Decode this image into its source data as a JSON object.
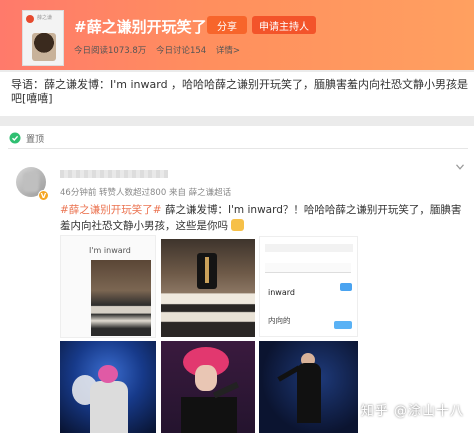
{
  "topic": {
    "title": "#薛之谦别开玩笑了#",
    "share_label": "分享",
    "host_label": "申请主持人",
    "stats": {
      "reads": "今日阅读1073.8万",
      "discussions": "今日讨论154",
      "details": "详情>"
    },
    "cover_text": "薛之谦"
  },
  "intro": {
    "text": "导语：薛之谦发博：I'm inward ，哈哈哈薛之谦别开玩笑了，腼腆害羞内向社恐文静小男孩是吧[嘻嘻]"
  },
  "feed": {
    "label": "置顶",
    "post": {
      "meta": "46分钟前 转赞人数超过800 来自 薛之谦超话",
      "hashtag": "#薛之谦别开玩笑了#",
      "text": "薛之谦发博：I'm inward？！哈哈哈薛之谦别开玩笑了，腼腆害羞内向社恐文静小男孩，这些是你吗",
      "images": {
        "screenshot_1_label": "I'm inward",
        "screenshot_2_label": "inward",
        "screenshot_2_sub": "内向的"
      }
    }
  },
  "watermark": "知乎 @涂山十八",
  "colors": {
    "header_gradient_start": "#ff7a6b",
    "header_gradient_end": "#ffa060",
    "hashtag": "#eb7350",
    "button_primary": "#f3542a"
  }
}
